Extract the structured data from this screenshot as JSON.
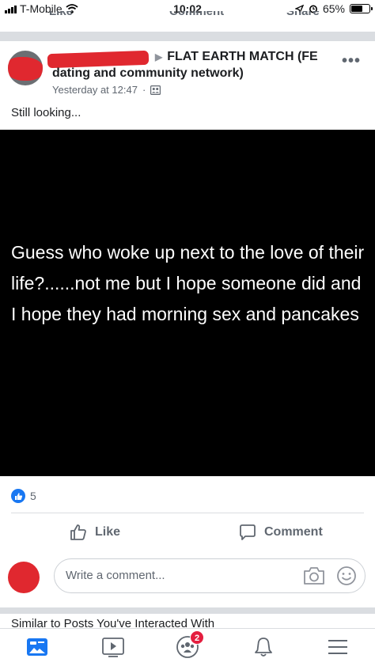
{
  "status_bar": {
    "carrier": "T-Mobile",
    "time": "10:02",
    "battery": "65%",
    "battery_level": 0.65
  },
  "prev_post_actions": [
    "Like",
    "Comment",
    "Share"
  ],
  "post": {
    "group_name_line1": "FLAT EARTH MATCH (FE",
    "group_name_line2": "dating and community network)",
    "timestamp": "Yesterday at 12:47",
    "text": "Still looking...",
    "image_caption": "Guess who woke up next to the love of their life?......not me but I hope someone did and I hope they had morning sex and pancakes",
    "reaction_count": "5",
    "like_label": "Like",
    "comment_label": "Comment",
    "comment_placeholder": "Write a comment..."
  },
  "section": {
    "title": "Similar to Posts You've Interacted With"
  },
  "tab_bar": {
    "items": [
      "news-feed",
      "watch",
      "groups",
      "notifications",
      "menu"
    ],
    "groups_badge": "2",
    "accent": "#1877f2"
  },
  "colors": {
    "redaction": "#e0282f",
    "badge": "#e41e3f",
    "image_bg": "#000000"
  }
}
